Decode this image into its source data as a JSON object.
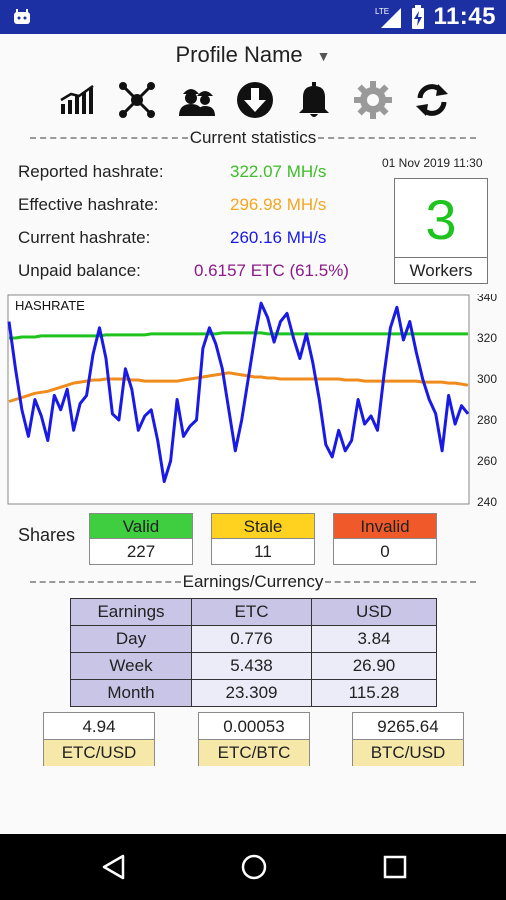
{
  "status_bar": {
    "time": "11:45",
    "network": "LTE",
    "icons": [
      "android-app-icon",
      "signal-icon",
      "battery-charging-icon"
    ]
  },
  "profile": {
    "name": "Profile Name"
  },
  "toolbar": {
    "icons": [
      "chart-icon",
      "network-icon",
      "workers-icon",
      "download-icon",
      "bell-icon",
      "gear-icon",
      "refresh-icon"
    ]
  },
  "current_stats": {
    "title": "Current statistics",
    "reported_label": "Reported hashrate:",
    "reported_value": "322.07 MH/s",
    "effective_label": "Effective hashrate:",
    "effective_value": "296.98 MH/s",
    "current_label": "Current hashrate:",
    "current_value": "260.16 MH/s",
    "unpaid_label": "Unpaid balance:",
    "unpaid_value": "0.6157 ETC (61.5%)",
    "datetime": "01 Nov 2019 11:30",
    "workers_count": "3",
    "workers_label": "Workers"
  },
  "colors": {
    "reported": "#3cbe28",
    "effective": "#f5a623",
    "current": "#1a1ae6",
    "unpaid": "#8b1a8b",
    "valid": "#3fce3f",
    "stale": "#ffd21f",
    "invalid": "#f05a2a",
    "status_bar": "#1c2fa3"
  },
  "chart_data": {
    "type": "line",
    "title": "HASHRATE",
    "ylim": [
      240,
      340
    ],
    "yticks": [
      240,
      260,
      280,
      300,
      320,
      340
    ],
    "grid": false,
    "series": [
      {
        "color": "#1ec31e",
        "values": [
          320,
          320,
          320.5,
          320.5,
          320.5,
          321,
          321,
          321,
          321,
          321,
          321,
          321,
          321,
          321,
          321,
          321.5,
          321.5,
          321.5,
          321.5,
          321.5,
          321.5,
          321.5,
          322,
          322,
          322,
          322,
          322,
          322,
          322,
          322,
          322,
          322,
          322,
          322.5,
          322.5,
          322.5,
          322.5,
          322.5,
          322.5,
          322.5,
          322,
          322,
          322,
          322,
          322,
          322,
          322,
          322,
          322,
          322,
          322,
          322,
          322,
          322,
          322,
          322,
          322,
          322,
          322,
          322,
          322,
          322,
          322,
          322,
          322,
          322,
          322,
          322,
          322,
          322,
          322,
          322
        ]
      },
      {
        "color": "#f08c1e",
        "values": [
          289,
          290,
          291,
          292,
          293,
          293.5,
          294,
          295,
          296,
          297,
          298,
          298.5,
          299,
          299.5,
          299.5,
          300,
          300,
          300,
          300,
          299.5,
          299.5,
          299,
          299,
          299,
          299,
          299,
          299,
          299.5,
          300,
          300.5,
          301,
          301.5,
          302,
          302.5,
          303,
          302.5,
          302,
          301.5,
          301,
          301,
          300.5,
          300.5,
          300,
          300,
          300,
          300,
          300,
          300,
          300,
          300,
          300,
          300,
          299.5,
          299.5,
          299.5,
          299,
          299,
          299,
          299,
          299,
          299,
          299,
          299,
          299,
          298.5,
          298.5,
          298.5,
          298.5,
          298,
          298,
          297.5,
          297
        ]
      },
      {
        "color": "#1a1ae6",
        "values": [
          328,
          305,
          285,
          272,
          290,
          282,
          270,
          292,
          285,
          295,
          275,
          288,
          292,
          312,
          325,
          310,
          283,
          280,
          305,
          295,
          275,
          282,
          285,
          270,
          250,
          260,
          290,
          272,
          277,
          280,
          315,
          325,
          317,
          305,
          285,
          265,
          280,
          300,
          320,
          337,
          330,
          318,
          328,
          332,
          320,
          310,
          322,
          308,
          290,
          268,
          262,
          275,
          265,
          270,
          290,
          278,
          282,
          275,
          302,
          325,
          335,
          319,
          328,
          313,
          300,
          290,
          283,
          265,
          292,
          278,
          287,
          283
        ]
      }
    ]
  },
  "shares": {
    "label": "Shares",
    "valid_label": "Valid",
    "valid_value": "227",
    "stale_label": "Stale",
    "stale_value": "11",
    "invalid_label": "Invalid",
    "invalid_value": "0"
  },
  "earnings": {
    "title": "Earnings/Currency",
    "header": [
      "Earnings",
      "ETC",
      "USD"
    ],
    "rows": [
      [
        "Day",
        "0.776",
        "3.84"
      ],
      [
        "Week",
        "5.438",
        "26.90"
      ],
      [
        "Month",
        "23.309",
        "115.28"
      ]
    ]
  },
  "rates": [
    {
      "value": "4.94",
      "label": "ETC/USD"
    },
    {
      "value": "0.00053",
      "label": "ETC/BTC"
    },
    {
      "value": "9265.64",
      "label": "BTC/USD"
    }
  ],
  "nav": {
    "icons": [
      "back-icon",
      "home-icon",
      "recents-icon"
    ]
  }
}
